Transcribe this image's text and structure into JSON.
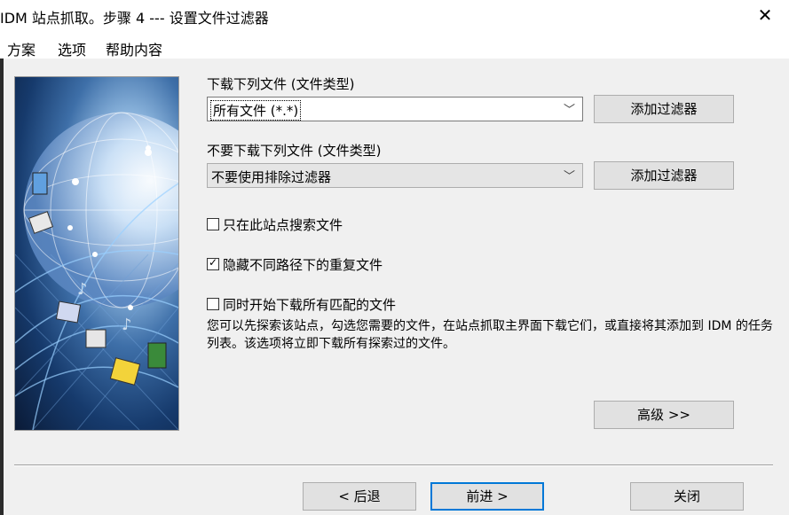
{
  "window": {
    "title": "IDM 站点抓取。步骤 4 --- 设置文件过滤器",
    "close_glyph": "✕"
  },
  "menu": [
    "方案",
    "选项",
    "帮助内容"
  ],
  "download": {
    "label": "下载下列文件 (文件类型)",
    "selected": "所有文件 (*.*)",
    "add_filter": "添加过滤器"
  },
  "exclude": {
    "label": "不要下载下列文件 (文件类型)",
    "selected": "不要使用排除过滤器",
    "add_filter": "添加过滤器"
  },
  "options": {
    "only_site": {
      "label": "只在此站点搜索文件",
      "checked": false
    },
    "hide_duplicates": {
      "label": "隐藏不同路径下的重复文件",
      "checked": true
    },
    "start_all": {
      "label": "同时开始下载所有匹配的文件",
      "checked": false
    }
  },
  "description": "您可以先探索该站点，勾选您需要的文件，在站点抓取主界面下载它们，或直接将其添加到 IDM 的任务列表。该选项将立即下载所有探索过的文件。",
  "buttons": {
    "advanced": "高级 >>",
    "back": "< 后退",
    "next": "前进 >",
    "close": "关闭"
  },
  "icons": {
    "dropdown": "chevron-down-icon",
    "checkbox_checked": "☑",
    "checkbox_empty": "☐"
  }
}
